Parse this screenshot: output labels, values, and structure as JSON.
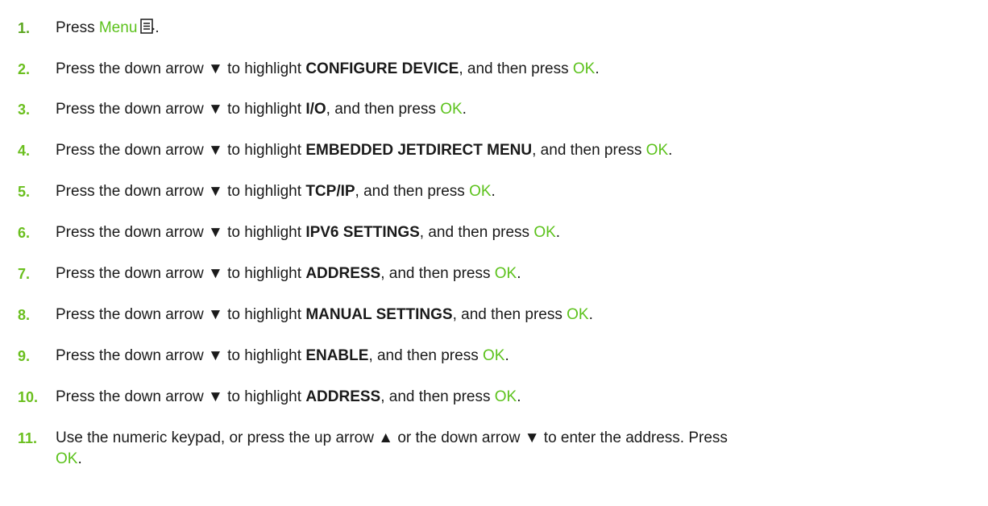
{
  "steps": [
    {
      "num": "1.",
      "press": "Press",
      "menu_word": "Menu",
      "period": "."
    },
    {
      "num": "2.",
      "pre": "Press the down arrow",
      "arrow": "▼",
      "mid": "to highlight",
      "item": "CONFIGURE DEVICE",
      "post": ", and then press",
      "ok": "OK",
      "end": "."
    },
    {
      "num": "3.",
      "pre": "Press the down arrow",
      "arrow": "▼",
      "mid": "to highlight",
      "item": "I/O",
      "post": ", and then press",
      "ok": "OK",
      "end": "."
    },
    {
      "num": "4.",
      "pre": "Press the down arrow",
      "arrow": "▼",
      "mid": "to highlight",
      "item": "EMBEDDED JETDIRECT MENU",
      "post": ", and then press",
      "ok": "OK",
      "end": "."
    },
    {
      "num": "5.",
      "pre": "Press the down arrow",
      "arrow": "▼",
      "mid": "to highlight",
      "item": "TCP/IP",
      "post": ", and then press",
      "ok": "OK",
      "end": "."
    },
    {
      "num": "6.",
      "pre": "Press the down arrow",
      "arrow": "▼",
      "mid": "to highlight",
      "item": "IPV6 SETTINGS",
      "post": ", and then press",
      "ok": "OK",
      "end": "."
    },
    {
      "num": "7.",
      "pre": "Press the down arrow",
      "arrow": "▼",
      "mid": "to highlight",
      "item": "ADDRESS",
      "post": ", and then press",
      "ok": "OK",
      "end": "."
    },
    {
      "num": "8.",
      "pre": "Press the down arrow",
      "arrow": "▼",
      "mid": "to highlight",
      "item": "MANUAL SETTINGS",
      "post": ", and then press",
      "ok": "OK",
      "end": "."
    },
    {
      "num": "9.",
      "pre": "Press the down arrow",
      "arrow": "▼",
      "mid": "to highlight",
      "item": "ENABLE",
      "post": ", and then press",
      "ok": "OK",
      "end": "."
    },
    {
      "num": "10.",
      "pre": "Press the down arrow",
      "arrow": "▼",
      "mid": "to highlight",
      "item": "ADDRESS",
      "post": ", and then press",
      "ok": "OK",
      "end": "."
    },
    {
      "num": "11.",
      "pre": "Use the numeric keypad, or press the up arrow",
      "up_arrow": "▲",
      "mid": "or the down arrow",
      "arrow": "▼",
      "post": "to enter the address. Press",
      "ok": "OK",
      "end": "."
    }
  ],
  "colors": {
    "accent_green": "#5cc21c",
    "number_green": "#6abf1e",
    "text": "#1a1a1a"
  },
  "icons": {
    "menu": "menu-icon"
  }
}
